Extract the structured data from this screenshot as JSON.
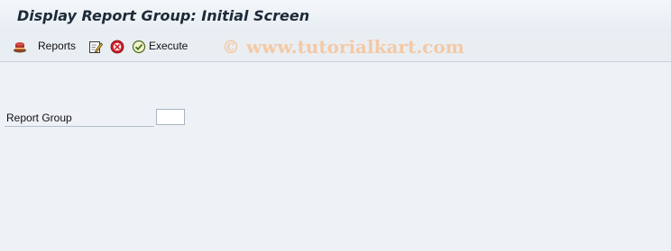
{
  "window": {
    "title": "Display Report Group: Initial Screen"
  },
  "toolbar": {
    "items": [
      {
        "icon": "reports-icon",
        "label": "Reports"
      },
      {
        "icon": "edit-icon",
        "label": ""
      },
      {
        "icon": "delete-icon",
        "label": ""
      },
      {
        "icon": "execute-icon",
        "label": "Execute"
      }
    ],
    "reports_label": "Reports",
    "execute_label": "Execute"
  },
  "watermark": {
    "text": "© www.tutorialkart.com"
  },
  "form": {
    "report_group_label": "Report Group",
    "report_group_value": ""
  },
  "colors": {
    "background": "#eef2f6",
    "title_text": "#1c2a38",
    "watermark": "#f4c9a5",
    "delete_icon": "#d0202a"
  }
}
